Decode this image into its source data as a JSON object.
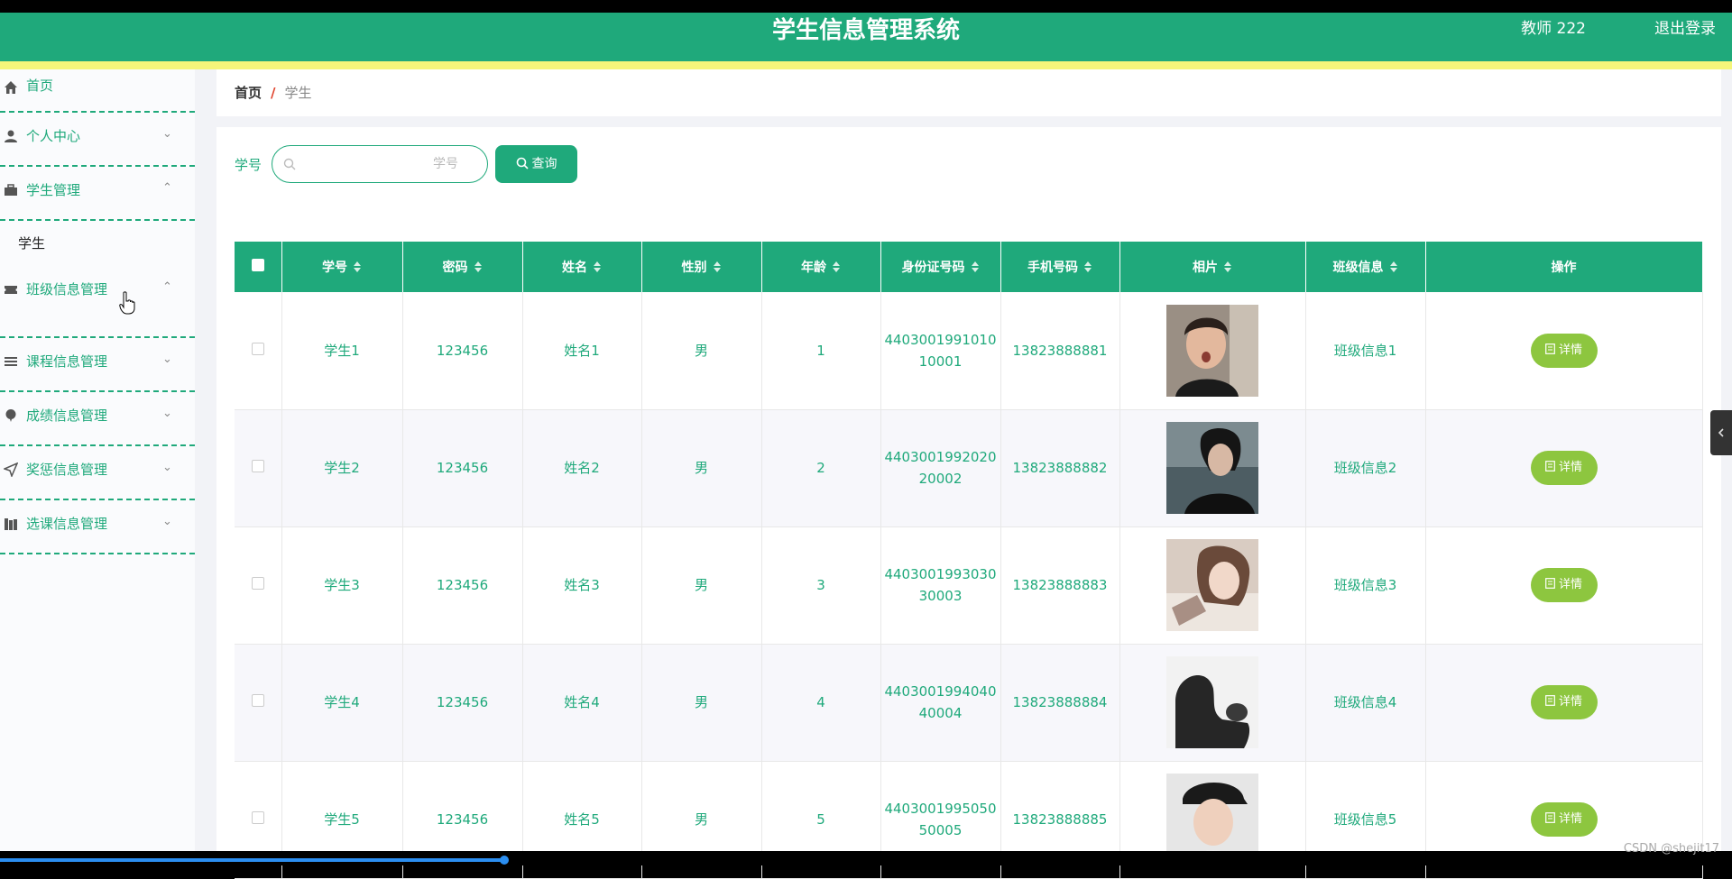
{
  "header": {
    "title": "学生信息管理系统",
    "user": "教师 222",
    "logout": "退出登录"
  },
  "sidebar": {
    "items": [
      {
        "label": "首页",
        "icon": "home-icon",
        "arrow": ""
      },
      {
        "label": "个人中心",
        "icon": "person-icon",
        "arrow": "⌄"
      },
      {
        "label": "学生管理",
        "icon": "briefcase-icon",
        "arrow": "⌃"
      },
      {
        "label": "班级信息管理",
        "icon": "ticket-icon",
        "arrow": "⌃"
      },
      {
        "label": "课程信息管理",
        "icon": "list-icon",
        "arrow": "⌄"
      },
      {
        "label": "成绩信息管理",
        "icon": "balloon-icon",
        "arrow": "⌄"
      },
      {
        "label": "奖惩信息管理",
        "icon": "send-icon",
        "arrow": "⌄"
      },
      {
        "label": "选课信息管理",
        "icon": "books-icon",
        "arrow": "⌄"
      }
    ],
    "submenu_item": "学生"
  },
  "breadcrumb": {
    "home": "首页",
    "separator": "/",
    "current": "学生"
  },
  "search": {
    "label": "学号",
    "placeholder": "学号",
    "button": "查询"
  },
  "table": {
    "columns": [
      "学号",
      "密码",
      "姓名",
      "性别",
      "年龄",
      "身份证号码",
      "手机号码",
      "相片",
      "班级信息",
      "操作"
    ],
    "rows": [
      {
        "xuehao": "学生1",
        "mima": "123456",
        "xingming": "姓名1",
        "xingbie": "男",
        "nianling": "1",
        "sfz1": "4403001991010",
        "sfz2": "10001",
        "shouji": "13823888881",
        "banji": "班级信息1",
        "action": "详情"
      },
      {
        "xuehao": "学生2",
        "mima": "123456",
        "xingming": "姓名2",
        "xingbie": "男",
        "nianling": "2",
        "sfz1": "4403001992020",
        "sfz2": "20002",
        "shouji": "13823888882",
        "banji": "班级信息2",
        "action": "详情"
      },
      {
        "xuehao": "学生3",
        "mima": "123456",
        "xingming": "姓名3",
        "xingbie": "男",
        "nianling": "3",
        "sfz1": "4403001993030",
        "sfz2": "30003",
        "shouji": "13823888883",
        "banji": "班级信息3",
        "action": "详情"
      },
      {
        "xuehao": "学生4",
        "mima": "123456",
        "xingming": "姓名4",
        "xingbie": "男",
        "nianling": "4",
        "sfz1": "4403001994040",
        "sfz2": "40004",
        "shouji": "13823888884",
        "banji": "班级信息4",
        "action": "详情"
      },
      {
        "xuehao": "学生5",
        "mima": "123456",
        "xingming": "姓名5",
        "xingbie": "男",
        "nianling": "5",
        "sfz1": "4403001995050",
        "sfz2": "50005",
        "shouji": "13823888885",
        "banji": "班级信息5",
        "action": "详情"
      }
    ]
  },
  "watermark": "CSDN @shejit17",
  "colors": {
    "primary": "#1fa97b",
    "accent_yellow": "#f5f57a",
    "detail_button": "#8dc63f"
  }
}
